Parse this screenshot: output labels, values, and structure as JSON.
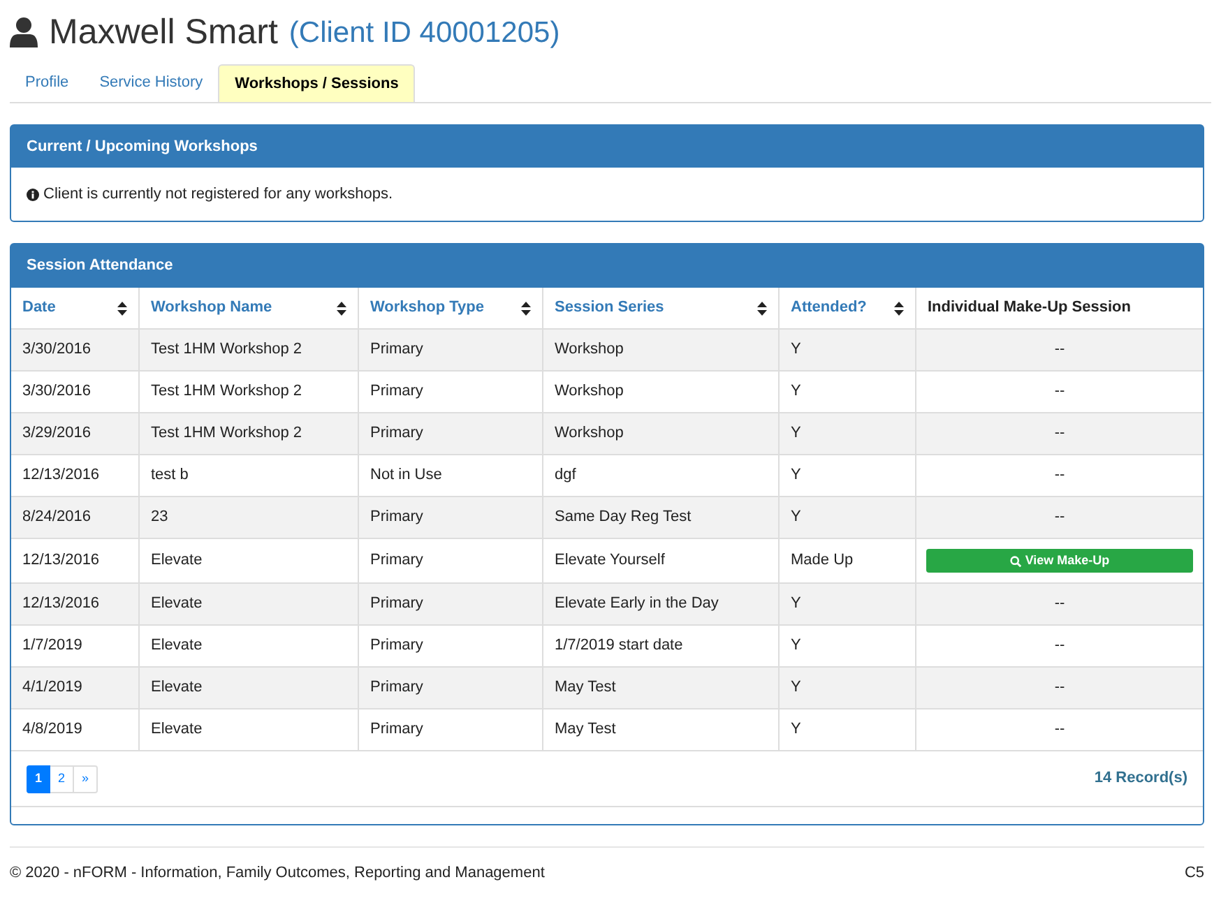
{
  "header": {
    "name": "Maxwell Smart",
    "client_id": "(Client ID 40001205)"
  },
  "tabs": [
    {
      "label": "Profile",
      "selected": false
    },
    {
      "label": "Service History",
      "selected": false
    },
    {
      "label": "Workshops / Sessions",
      "selected": true
    }
  ],
  "current_workshops": {
    "title": "Current / Upcoming Workshops",
    "message": "Client is currently not registered for any workshops."
  },
  "attendance": {
    "title": "Session Attendance",
    "columns": [
      {
        "label": "Date",
        "sortable": true
      },
      {
        "label": "Workshop Name",
        "sortable": true
      },
      {
        "label": "Workshop Type",
        "sortable": true
      },
      {
        "label": "Session Series",
        "sortable": true
      },
      {
        "label": "Attended?",
        "sortable": true
      },
      {
        "label": "Individual Make-Up Session",
        "sortable": false
      }
    ],
    "rows": [
      {
        "cells": [
          "3/30/2016",
          "Test 1HM Workshop 2",
          "Primary",
          "Workshop",
          "Y"
        ],
        "makeup": {
          "kind": "text",
          "text": "--"
        }
      },
      {
        "cells": [
          "3/30/2016",
          "Test 1HM Workshop 2",
          "Primary",
          "Workshop",
          "Y"
        ],
        "makeup": {
          "kind": "text",
          "text": "--"
        }
      },
      {
        "cells": [
          "3/29/2016",
          "Test 1HM Workshop 2",
          "Primary",
          "Workshop",
          "Y"
        ],
        "makeup": {
          "kind": "text",
          "text": "--"
        }
      },
      {
        "cells": [
          "12/13/2016",
          "test b",
          "Not in Use",
          "dgf",
          "Y"
        ],
        "makeup": {
          "kind": "text",
          "text": "--"
        }
      },
      {
        "cells": [
          "8/24/2016",
          "23",
          "Primary",
          "Same Day Reg Test",
          "Y"
        ],
        "makeup": {
          "kind": "text",
          "text": "--"
        }
      },
      {
        "cells": [
          "12/13/2016",
          "Elevate",
          "Primary",
          "Elevate Yourself",
          "Made Up"
        ],
        "makeup": {
          "kind": "button",
          "text": "View Make-Up"
        }
      },
      {
        "cells": [
          "12/13/2016",
          "Elevate",
          "Primary",
          "Elevate Early in the Day",
          "Y"
        ],
        "makeup": {
          "kind": "text",
          "text": "--"
        }
      },
      {
        "cells": [
          "1/7/2019",
          "Elevate",
          "Primary",
          "1/7/2019 start date",
          "Y"
        ],
        "makeup": {
          "kind": "text",
          "text": "--"
        }
      },
      {
        "cells": [
          "4/1/2019",
          "Elevate",
          "Primary",
          "May Test",
          "Y"
        ],
        "makeup": {
          "kind": "text",
          "text": "--"
        }
      },
      {
        "cells": [
          "4/8/2019",
          "Elevate",
          "Primary",
          "May Test",
          "Y"
        ],
        "makeup": {
          "kind": "text",
          "text": "--"
        }
      }
    ],
    "pagination": [
      {
        "label": "1",
        "selected": true
      },
      {
        "label": "2",
        "selected": false
      },
      {
        "label": "»",
        "selected": false
      }
    ],
    "record_count": "14 Record(s)"
  },
  "footer": {
    "copyright": "© 2020 - nFORM - Information, Family Outcomes, Reporting and Management",
    "version": "C5"
  }
}
